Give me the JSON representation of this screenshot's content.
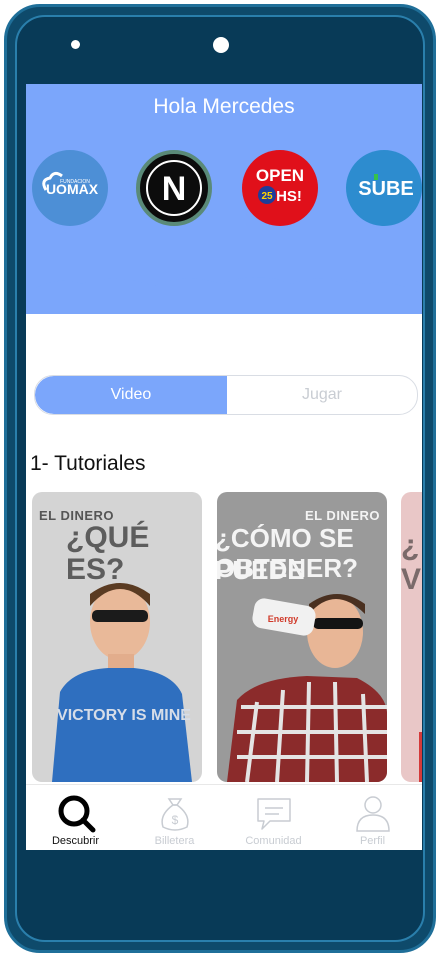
{
  "greeting": "Hola Mercedes",
  "brands": [
    {
      "name": "UOMAX",
      "small": "FUNDACION",
      "icon": "uomax-logo"
    },
    {
      "name": "N",
      "icon": "n-logo"
    },
    {
      "name": "OPEN",
      "badge": "25",
      "sub": "HS!",
      "icon": "open25-logo"
    },
    {
      "name": "SUBE",
      "icon": "sube-logo"
    }
  ],
  "segments": {
    "video": "Video",
    "jugar": "Jugar",
    "active": "video"
  },
  "section_title": "1- Tutoriales",
  "cards": [
    {
      "small": "EL DINERO",
      "big": "¿QUÉ ES?",
      "shirt": "VICTORY IS MINE"
    },
    {
      "small": "EL DINERO",
      "big_line1": "¿CÓMO SE PUEDE",
      "big_line2": "OBTENER?",
      "can": "Energy"
    },
    {
      "big_line1": "¿",
      "big_line2": "V"
    }
  ],
  "tabs": [
    {
      "label": "Descubrir",
      "icon": "search-icon",
      "active": true
    },
    {
      "label": "Billetera",
      "icon": "money-bag-icon",
      "active": false
    },
    {
      "label": "Comunidad",
      "icon": "chat-icon",
      "active": false
    },
    {
      "label": "Perfil",
      "icon": "user-icon",
      "active": false
    }
  ],
  "colors": {
    "accent": "#7ba6fb",
    "phone": "#0e4a6b",
    "inactive": "#c8ccd2"
  }
}
